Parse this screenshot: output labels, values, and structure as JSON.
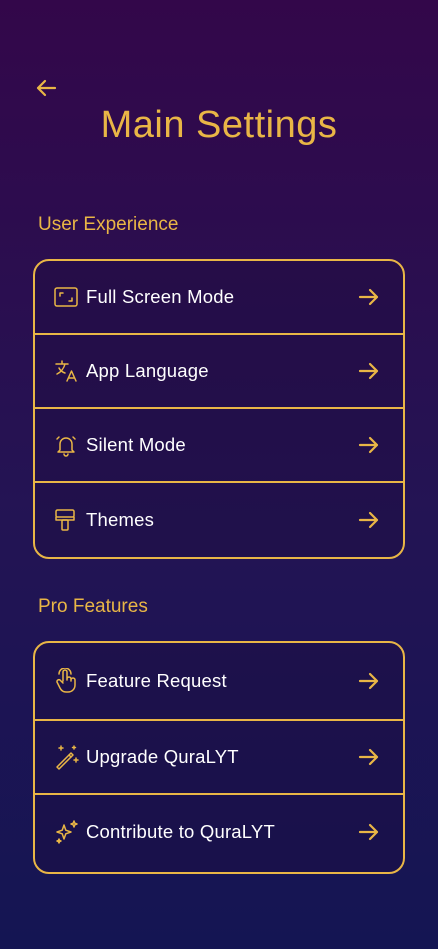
{
  "header": {
    "back_icon": "arrow-left-icon",
    "title": "Main Settings"
  },
  "sections": [
    {
      "label": "User Experience",
      "items": [
        {
          "label": "Full Screen Mode",
          "icon": "fullscreen-icon"
        },
        {
          "label": "App Language",
          "icon": "translate-icon"
        },
        {
          "label": "Silent Mode",
          "icon": "bell-icon"
        },
        {
          "label": "Themes",
          "icon": "paint-roller-icon"
        }
      ]
    },
    {
      "label": "Pro Features",
      "items": [
        {
          "label": "Feature Request",
          "icon": "hand-pointer-icon"
        },
        {
          "label": "Upgrade QuraLYT",
          "icon": "magic-wand-icon"
        },
        {
          "label": "Contribute to QuraLYT",
          "icon": "sparkles-icon"
        }
      ]
    }
  ],
  "colors": {
    "accent": "#e9b646",
    "background_top": "#33074a",
    "background_bottom": "#141553",
    "text": "#ffffff"
  }
}
